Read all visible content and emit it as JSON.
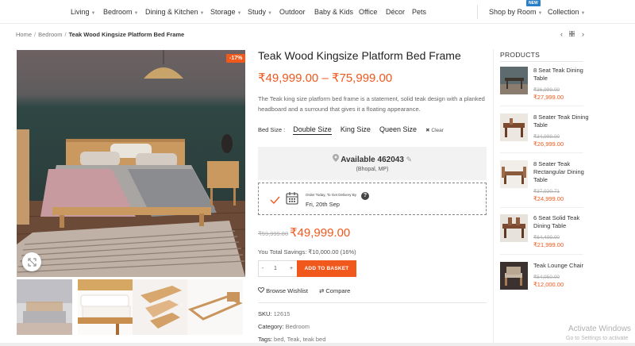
{
  "nav": {
    "items": [
      {
        "label": "Living",
        "chevron": true
      },
      {
        "label": "Bedroom",
        "chevron": true
      },
      {
        "label": "Dining & Kitchen",
        "chevron": true
      },
      {
        "label": "Storage",
        "chevron": true
      },
      {
        "label": "Study",
        "chevron": true
      },
      {
        "label": "Outdoor",
        "chevron": false
      },
      {
        "label": "Baby & Kids",
        "chevron": false
      },
      {
        "label": "Office",
        "chevron": false
      },
      {
        "label": "Décor",
        "chevron": false
      },
      {
        "label": "Pets",
        "chevron": false
      }
    ],
    "shop_by_room": "Shop by Room",
    "new_badge": "NEW",
    "collection": "Collection"
  },
  "breadcrumb": {
    "home": "Home",
    "category": "Bedroom",
    "current": "Teak Wood Kingsize Platform Bed Frame"
  },
  "product": {
    "sale_badge": "-17%",
    "title": "Teak Wood Kingsize Platform Bed Frame",
    "price_range": "₹49,999.00 – ₹75,999.00",
    "description": "The Teak king size platform bed frame is a statement, solid teak design with a planked headboard and a surround that gives it a floating appearance.",
    "bed_size_label": "Bed Size :",
    "sizes": [
      "Double Size",
      "King Size",
      "Queen Size"
    ],
    "clear_label": "Clear",
    "availability": "Available 462043",
    "location": "(Bhopal, MP)",
    "delivery_small": "Order Today, To Get Delivery By",
    "delivery_date": "Fri, 20th Sep",
    "old_price": "₹59,999.00",
    "new_price": "₹49,999.00",
    "savings": "You Total Savings: ₹10,000.00 (16%)",
    "qty_minus": "-",
    "qty_value": "1",
    "qty_plus": "+",
    "add_to_basket": "ADD TO BASKET",
    "wishlist": "Browse Wishlist",
    "compare": "Compare",
    "sku_label": "SKU:",
    "sku": "12615",
    "category_label": "Category:",
    "category": "Bedroom",
    "tags_label": "Tags:",
    "tags": "bed, Teak, teak bed"
  },
  "sidebar": {
    "title": "PRODUCTS",
    "items": [
      {
        "name": "8 Seat Teak Dining Table",
        "old": "₹36,999.00",
        "new": "₹27,999.00"
      },
      {
        "name": "8 Seater Teak Dining Table",
        "old": "₹34,999.00",
        "new": "₹26,999.00"
      },
      {
        "name": "8 Seater Teak Rectangular Dining Table",
        "old": "₹37,920.71",
        "new": "₹24,999.00"
      },
      {
        "name": "6 Seat Solid Teak Dining Table",
        "old": "₹64,499.00",
        "new": "₹21,999.00"
      },
      {
        "name": "Teak Lounge Chair",
        "old": "₹54,950.00",
        "new": "₹12,000.00"
      }
    ]
  },
  "os": {
    "activate": "Activate Windows",
    "goto": "Go to Settings to activate"
  },
  "colors": {
    "accent": "#f0581c",
    "badge_blue": "#2a7fc9"
  }
}
